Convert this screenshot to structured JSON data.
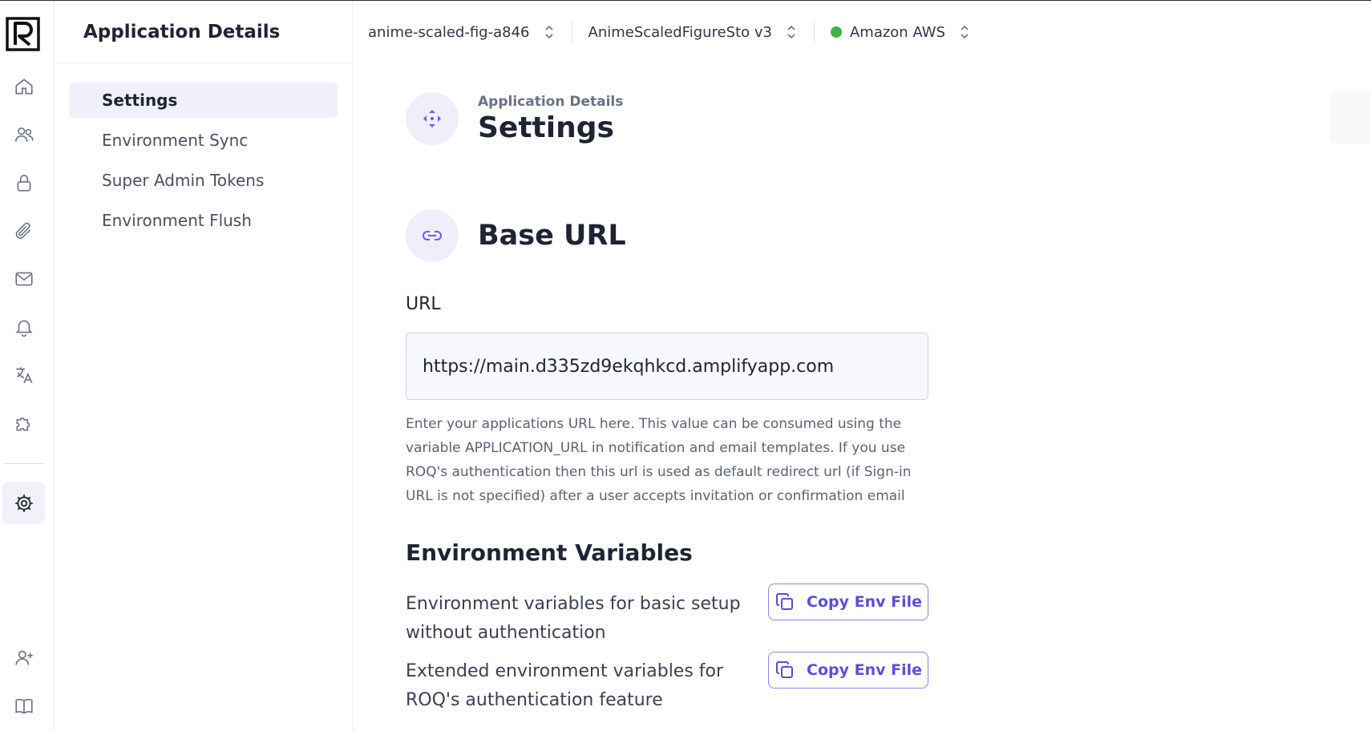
{
  "app": {
    "logo_letter": "R"
  },
  "rail": {
    "items": [
      {
        "name": "home-icon"
      },
      {
        "name": "users-icon"
      },
      {
        "name": "lock-icon"
      },
      {
        "name": "paperclip-icon"
      },
      {
        "name": "mail-icon"
      },
      {
        "name": "bell-icon"
      },
      {
        "name": "translate-icon"
      },
      {
        "name": "puzzle-icon"
      }
    ],
    "active": "gear-icon",
    "bottom": [
      {
        "name": "add-user-icon"
      },
      {
        "name": "book-icon"
      }
    ]
  },
  "subnav": {
    "title": "Application Details",
    "items": [
      {
        "label": "Settings",
        "active": true
      },
      {
        "label": "Environment Sync"
      },
      {
        "label": "Super Admin Tokens"
      },
      {
        "label": "Environment Flush"
      }
    ]
  },
  "topbar": {
    "project": "anime-scaled-fig-a846",
    "app": "AnimeScaledFigureSto v3",
    "environment": "Amazon AWS",
    "environment_status_color": "#3fb04a"
  },
  "header": {
    "breadcrumb": "Application Details",
    "title": "Settings"
  },
  "base_url": {
    "title": "Base URL",
    "field_label": "URL",
    "value": "https://main.d335zd9ekqhkcd.amplifyapp.com",
    "help": "Enter your applications URL here. This value can be consumed using the variable APPLICATION_URL in notification and email templates. If you use ROQ's authentication then this url is used as default redirect url (if Sign-in URL is not specified) after a user accepts invitation or confirmation email"
  },
  "env_vars": {
    "title": "Environment Variables",
    "rows": [
      {
        "description": "Environment variables for basic setup without authentication",
        "button": "Copy Env File"
      },
      {
        "description": "Extended environment variables for ROQ's authentication feature",
        "button": "Copy Env File"
      }
    ]
  },
  "colors": {
    "accent": "#5a4fd6",
    "accent_soft": "#f0eefb"
  }
}
